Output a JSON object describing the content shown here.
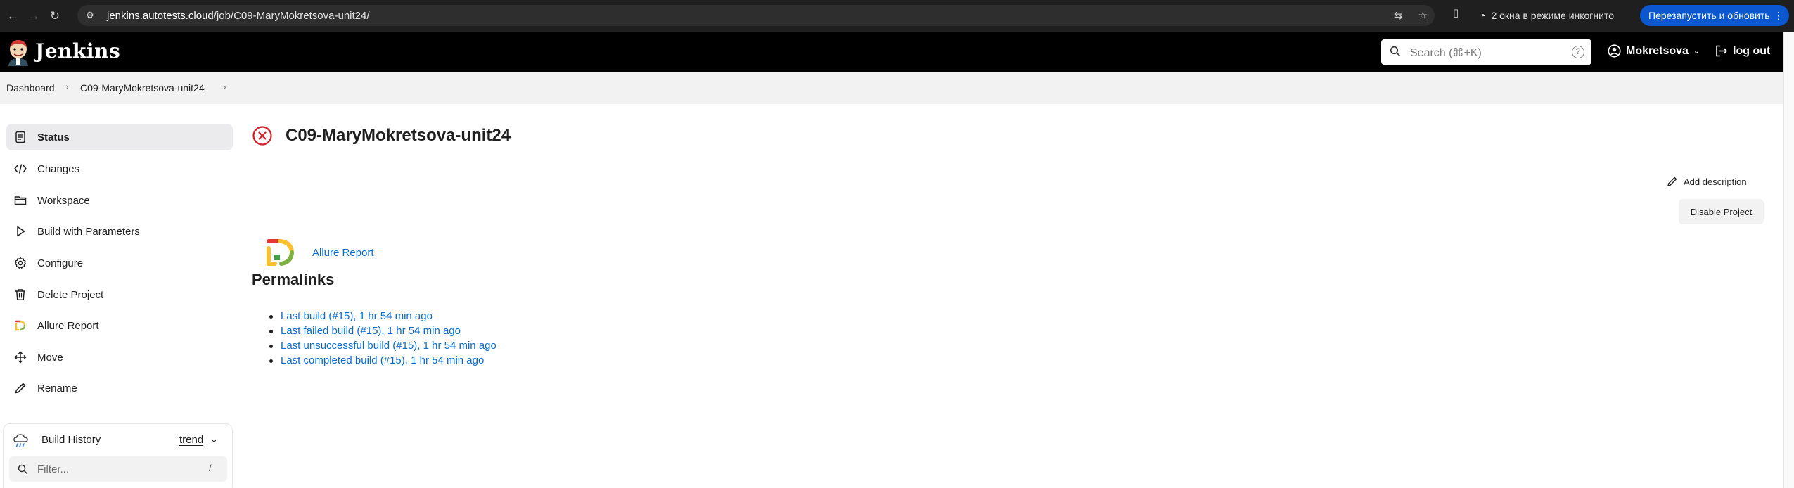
{
  "browser": {
    "url_domain": "jenkins.autotests.cloud",
    "url_path": "/job/C09-MaryMokretsova-unit24/",
    "incognito_label": "2 окна в режиме инкогнито",
    "restart_label": "Перезапустить и обновить"
  },
  "header": {
    "logo_text": "Jenkins",
    "search_placeholder": "Search (⌘+K)",
    "user_name": "Mokretsova",
    "logout_label": "log out"
  },
  "breadcrumb": [
    "Dashboard",
    "C09-MaryMokretsova-unit24"
  ],
  "sidebar": {
    "items": [
      {
        "label": "Status",
        "icon": "status-icon"
      },
      {
        "label": "Changes",
        "icon": "code-icon"
      },
      {
        "label": "Workspace",
        "icon": "folder-icon"
      },
      {
        "label": "Build with Parameters",
        "icon": "play-icon"
      },
      {
        "label": "Configure",
        "icon": "gear-icon"
      },
      {
        "label": "Delete Project",
        "icon": "trash-icon"
      },
      {
        "label": "Allure Report",
        "icon": "allure-icon"
      },
      {
        "label": "Move",
        "icon": "move-icon"
      },
      {
        "label": "Rename",
        "icon": "pencil-icon"
      }
    ],
    "build_history": {
      "title": "Build History",
      "trend_label": "trend",
      "filter_placeholder": "Filter...",
      "filter_shortcut": "/"
    }
  },
  "main": {
    "title": "C09-MaryMokretsova-unit24",
    "status": "failed",
    "add_description_label": "Add description",
    "disable_button_label": "Disable Project",
    "allure_link_label": "Allure Report",
    "permalinks_title": "Permalinks",
    "permalinks": [
      "Last build (#15), 1 hr 54 min ago",
      "Last failed build (#15), 1 hr 54 min ago",
      "Last unsuccessful build (#15), 1 hr 54 min ago",
      "Last completed build (#15), 1 hr 54 min ago"
    ]
  },
  "colors": {
    "link": "#0b6bcb",
    "failed": "#d42029",
    "header_bg": "#000000",
    "restart_button": "#0b57d0"
  }
}
